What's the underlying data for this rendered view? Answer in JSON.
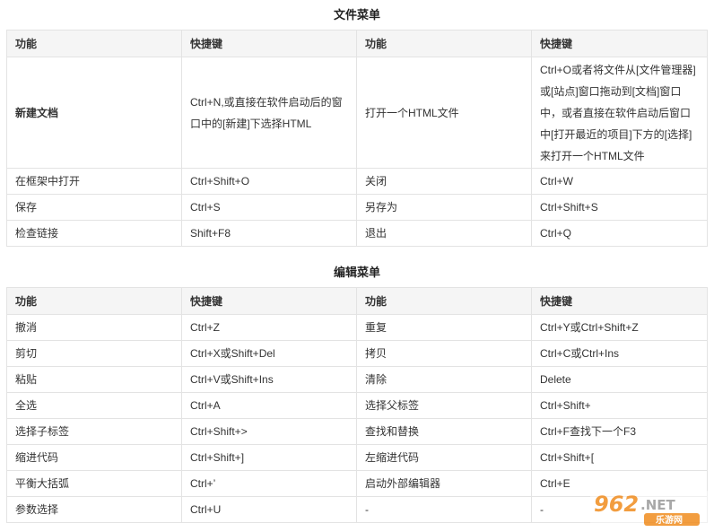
{
  "file_menu": {
    "title": "文件菜单",
    "headers": [
      "功能",
      "快捷键",
      "功能",
      "快捷键"
    ],
    "rows": [
      [
        "新建文档",
        "Ctrl+N,或直接在软件启动后的窗口中的[新建]下选择HTML",
        "打开一个HTML文件",
        "Ctrl+O或者将文件从[文件管理器]或[站点]窗口拖动到[文档]窗口中，或者直接在软件启动后窗口中[打开最近的项目]下方的[选择]来打开一个HTML文件"
      ],
      [
        "在框架中打开",
        "Ctrl+Shift+O",
        "关闭",
        "Ctrl+W"
      ],
      [
        "保存",
        "Ctrl+S",
        "另存为",
        "Ctrl+Shift+S"
      ],
      [
        "检查链接",
        "Shift+F8",
        "退出",
        "Ctrl+Q"
      ]
    ]
  },
  "edit_menu": {
    "title": "编辑菜单",
    "headers": [
      "功能",
      "快捷键",
      "功能",
      "快捷键"
    ],
    "rows": [
      [
        "撤消",
        "Ctrl+Z",
        "重复",
        "Ctrl+Y或Ctrl+Shift+Z"
      ],
      [
        "剪切",
        "Ctrl+X或Shift+Del",
        "拷贝",
        "Ctrl+C或Ctrl+Ins"
      ],
      [
        "粘贴",
        "Ctrl+V或Shift+Ins",
        "清除",
        "Delete"
      ],
      [
        "全选",
        "Ctrl+A",
        "选择父标签",
        "Ctrl+Shift+"
      ],
      [
        "选择子标签",
        "Ctrl+Shift+>",
        "查找和替换",
        "Ctrl+F查找下一个F3"
      ],
      [
        "缩进代码",
        "Ctrl+Shift+]",
        "左缩进代码",
        "Ctrl+Shift+["
      ],
      [
        "平衡大括弧",
        "Ctrl+’",
        "启动外部编辑器",
        "Ctrl+E"
      ],
      [
        "参数选择",
        "Ctrl+U",
        "-",
        "-"
      ]
    ]
  },
  "watermark": {
    "logo_text": "962.NET",
    "sub_text": "乐游网",
    "color": "#f08c1e"
  }
}
